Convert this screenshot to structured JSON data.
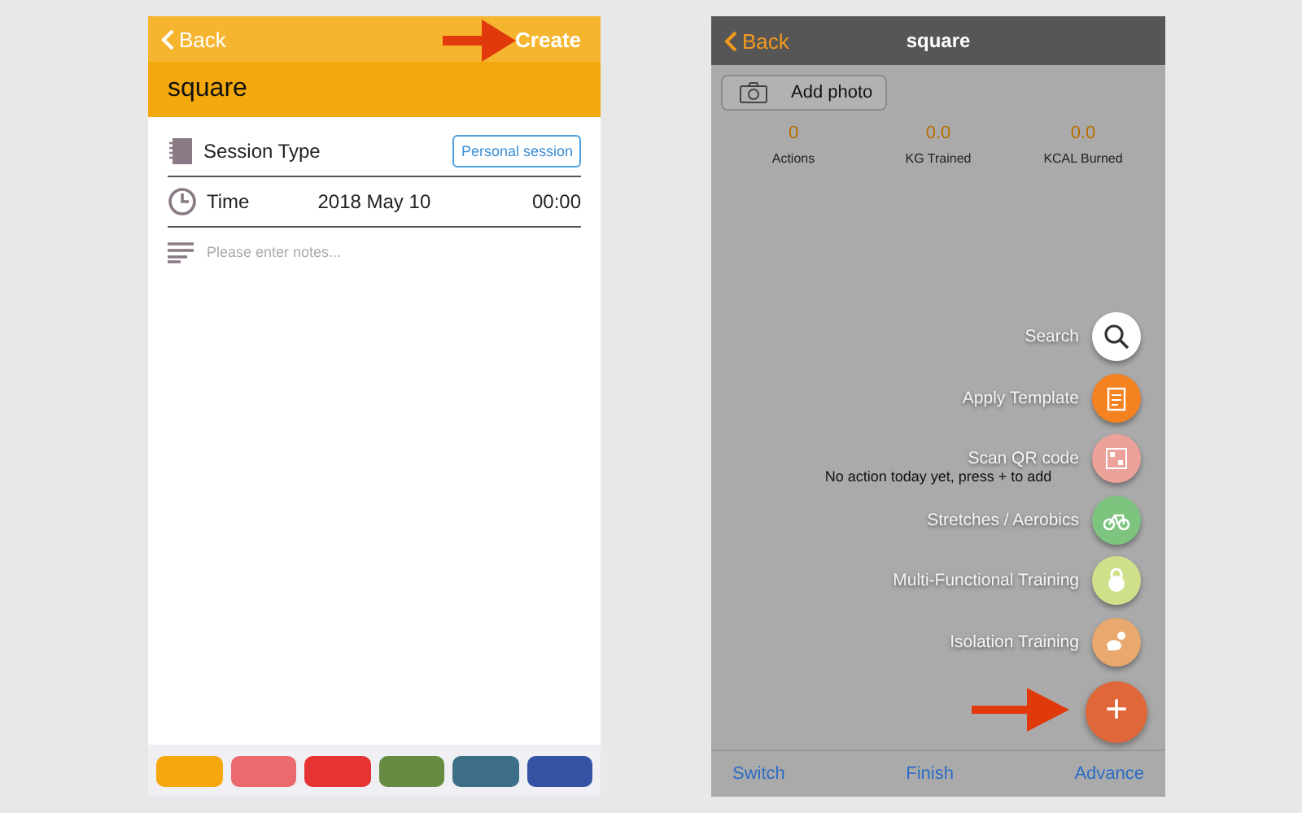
{
  "left_screen": {
    "nav": {
      "back": "Back",
      "action": "Create"
    },
    "title": "square",
    "session_type": {
      "label": "Session Type",
      "value": "Personal session"
    },
    "time": {
      "label": "Time",
      "date": "2018 May 10",
      "clock": "00:00"
    },
    "notes": {
      "placeholder": "Please enter notes..."
    },
    "swatches": [
      {
        "color": "#f5a80d"
      },
      {
        "color": "#ea6a6e"
      },
      {
        "color": "#e63434"
      },
      {
        "color": "#658c42"
      },
      {
        "color": "#3c6e88"
      },
      {
        "color": "#3553a4"
      }
    ]
  },
  "right_screen": {
    "nav": {
      "back": "Back",
      "title": "square"
    },
    "add_photo": "Add photo",
    "stats": [
      {
        "value": "0",
        "label": "Actions"
      },
      {
        "value": "0.0",
        "label": "KG Trained"
      },
      {
        "value": "0.0",
        "label": "KCAL Burned"
      }
    ],
    "empty_message": "No action today yet, press + to add",
    "menu": [
      {
        "label": "Search",
        "kind": "search",
        "color": "#ffffff"
      },
      {
        "label": "Apply Template",
        "kind": "template",
        "color": "#f58220"
      },
      {
        "label": "Scan QR code",
        "kind": "qr",
        "color": "#eda19b"
      },
      {
        "label": "Stretches / Aerobics",
        "kind": "bike",
        "color": "#7dc47f"
      },
      {
        "label": "Multi-Functional Training",
        "kind": "kettlebell",
        "color": "#cfe08a"
      },
      {
        "label": "Isolation Training",
        "kind": "muscle",
        "color": "#e9a86d"
      }
    ],
    "fab": "+",
    "tabs": [
      "Switch",
      "Finish",
      "Advance"
    ]
  }
}
